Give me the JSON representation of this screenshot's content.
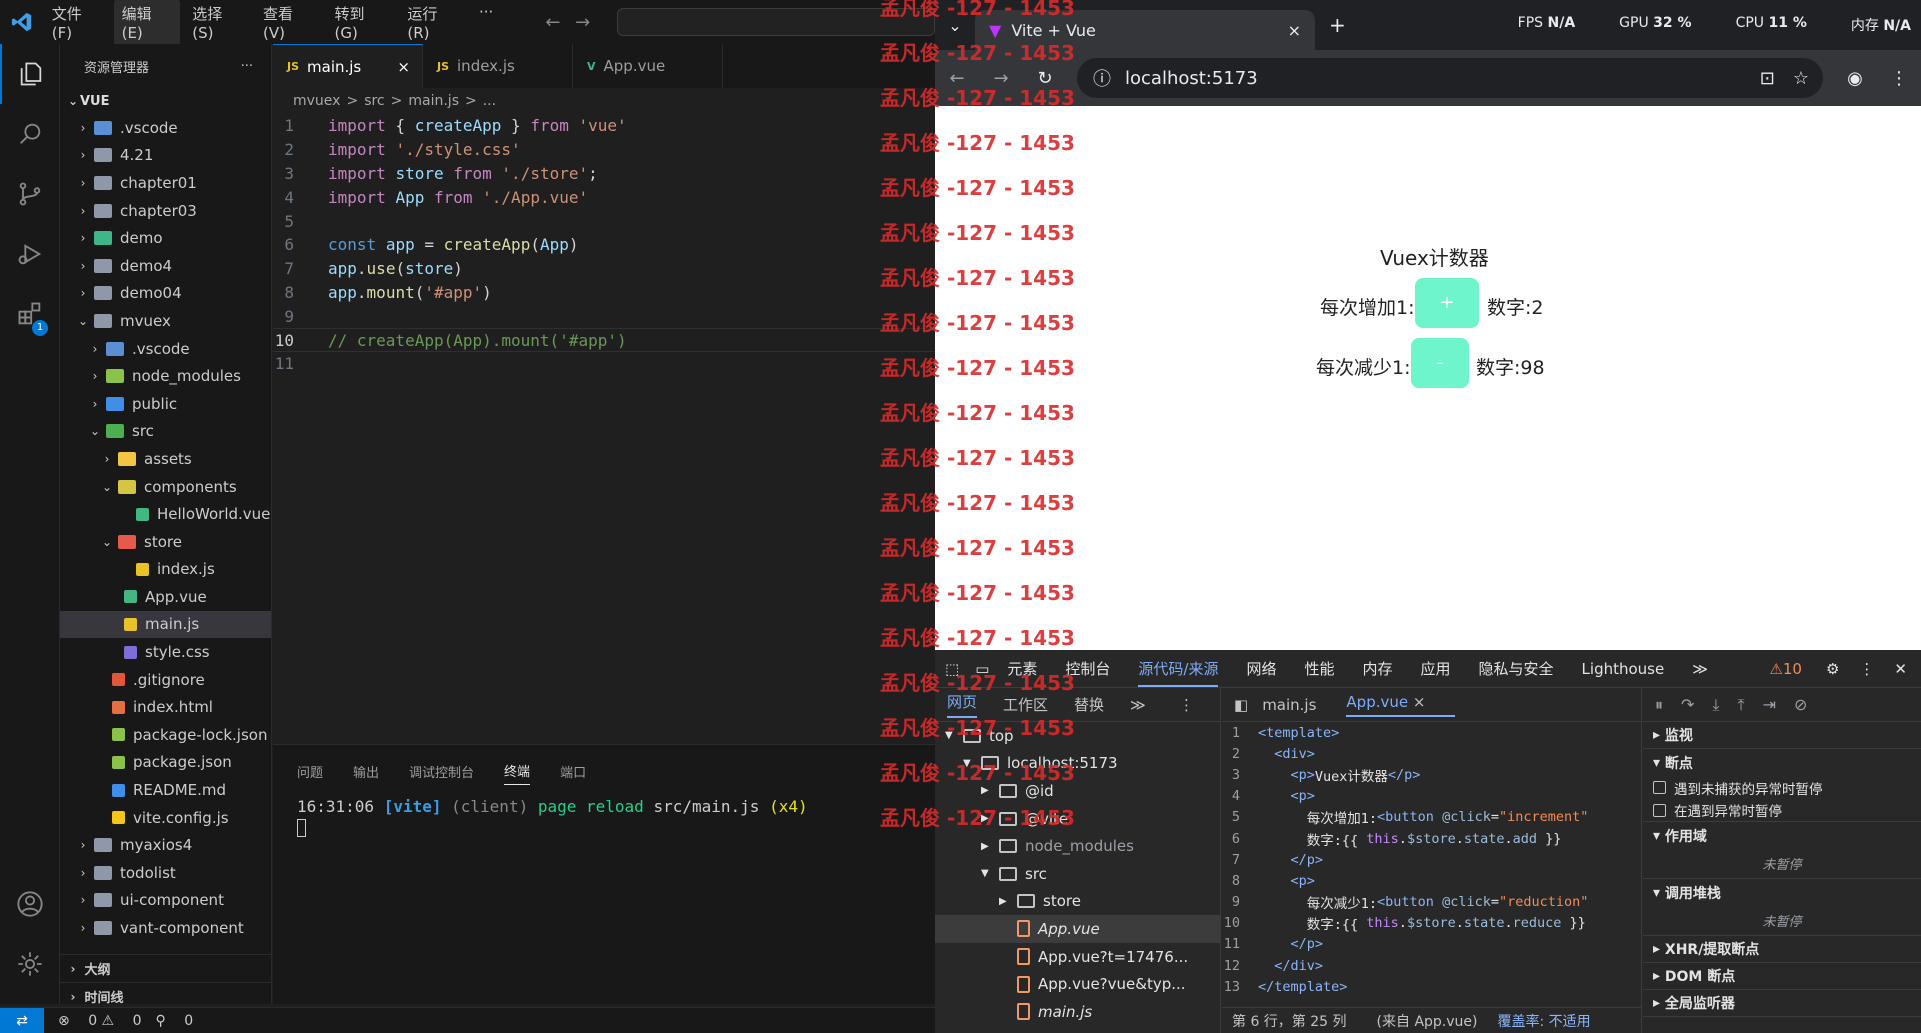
{
  "vscode": {
    "menus": [
      "文件(F)",
      "编辑(E)",
      "选择(S)",
      "查看(V)",
      "转到(G)",
      "运行(R)",
      "···"
    ],
    "explorer": {
      "title": "资源管理器",
      "more": "···",
      "root": "VUE",
      "items": [
        {
          "label": ".vscode",
          "indent": 1,
          "chev": "›",
          "color": "#5a8fd6"
        },
        {
          "label": "4.21",
          "indent": 1,
          "chev": "›",
          "color": "#8f98a8"
        },
        {
          "label": "chapter01",
          "indent": 1,
          "chev": "›",
          "color": "#8f98a8"
        },
        {
          "label": "chapter03",
          "indent": 1,
          "chev": "›",
          "color": "#8f98a8"
        },
        {
          "label": "demo",
          "indent": 1,
          "chev": "›",
          "color": "#3fb58a"
        },
        {
          "label": "demo4",
          "indent": 1,
          "chev": "›",
          "color": "#8f98a8"
        },
        {
          "label": "demo04",
          "indent": 1,
          "chev": "›",
          "color": "#8f98a8"
        },
        {
          "label": "mvuex",
          "indent": 1,
          "chev": "⌄",
          "color": "#8f98a8"
        },
        {
          "label": ".vscode",
          "indent": 2,
          "chev": "›",
          "color": "#5a8fd6"
        },
        {
          "label": "node_modules",
          "indent": 2,
          "chev": "›",
          "color": "#8bc34a"
        },
        {
          "label": "public",
          "indent": 2,
          "chev": "›",
          "color": "#3f8fe8"
        },
        {
          "label": "src",
          "indent": 2,
          "chev": "⌄",
          "color": "#4caf50"
        },
        {
          "label": "assets",
          "indent": 3,
          "chev": "›",
          "color": "#f4c542"
        },
        {
          "label": "components",
          "indent": 3,
          "chev": "⌄",
          "color": "#d4c542"
        },
        {
          "label": "HelloWorld.vue",
          "indent": 4,
          "chev": "",
          "color": "#41b883"
        },
        {
          "label": "store",
          "indent": 3,
          "chev": "⌄",
          "color": "#e45b4d"
        },
        {
          "label": "index.js",
          "indent": 4,
          "chev": "",
          "color": "#e8c228"
        },
        {
          "label": "App.vue",
          "indent": 3,
          "chev": "",
          "color": "#41b883"
        },
        {
          "label": "main.js",
          "indent": 3,
          "chev": "",
          "color": "#e8c228",
          "selected": true
        },
        {
          "label": "style.css",
          "indent": 3,
          "chev": "",
          "color": "#7e6fd8"
        },
        {
          "label": ".gitignore",
          "indent": 2,
          "chev": "",
          "color": "#e2573a"
        },
        {
          "label": "index.html",
          "indent": 2,
          "chev": "",
          "color": "#e5703f"
        },
        {
          "label": "package-lock.json",
          "indent": 2,
          "chev": "",
          "color": "#8bc34a"
        },
        {
          "label": "package.json",
          "indent": 2,
          "chev": "",
          "color": "#8bc34a"
        },
        {
          "label": "README.md",
          "indent": 2,
          "chev": "",
          "color": "#3f8fe8"
        },
        {
          "label": "vite.config.js",
          "indent": 2,
          "chev": "",
          "color": "#f5c518"
        },
        {
          "label": "myaxios4",
          "indent": 1,
          "chev": "›",
          "color": "#8f98a8"
        },
        {
          "label": "todolist",
          "indent": 1,
          "chev": "›",
          "color": "#8f98a8"
        },
        {
          "label": "ui-component",
          "indent": 1,
          "chev": "›",
          "color": "#8f98a8"
        },
        {
          "label": "vant-component",
          "indent": 1,
          "chev": "›",
          "color": "#8f98a8"
        }
      ],
      "outline": "大纲",
      "timeline": "时间线"
    },
    "tabs": [
      {
        "label": "main.js",
        "active": true,
        "icon": "JS",
        "close": "×"
      },
      {
        "label": "index.js",
        "active": false,
        "icon": "JS"
      },
      {
        "label": "App.vue",
        "active": false,
        "icon": "V"
      }
    ],
    "breadcrumb": [
      "mvuex",
      ">",
      "src",
      ">",
      "main.js",
      ">",
      "..."
    ],
    "code": [
      [
        [
          "kw",
          "import"
        ],
        [
          "pl",
          " { "
        ],
        [
          "var",
          "createApp"
        ],
        [
          "pl",
          " } "
        ],
        [
          "kw",
          "from"
        ],
        [
          "pl",
          " "
        ],
        [
          "str",
          "'vue'"
        ]
      ],
      [
        [
          "kw",
          "import"
        ],
        [
          "pl",
          " "
        ],
        [
          "str",
          "'./style.css'"
        ]
      ],
      [
        [
          "kw",
          "import"
        ],
        [
          "pl",
          " "
        ],
        [
          "var",
          "store"
        ],
        [
          "pl",
          " "
        ],
        [
          "kw",
          "from"
        ],
        [
          "pl",
          " "
        ],
        [
          "str",
          "'./store'"
        ],
        [
          "pl",
          ";"
        ]
      ],
      [
        [
          "kw",
          "import"
        ],
        [
          "pl",
          " "
        ],
        [
          "var",
          "App"
        ],
        [
          "pl",
          " "
        ],
        [
          "kw",
          "from"
        ],
        [
          "pl",
          " "
        ],
        [
          "str",
          "'./App.vue'"
        ]
      ],
      [],
      [
        [
          "kb",
          "const"
        ],
        [
          "pl",
          " "
        ],
        [
          "var",
          "app"
        ],
        [
          "pl",
          " = "
        ],
        [
          "fn",
          "createApp"
        ],
        [
          "pl",
          "("
        ],
        [
          "var",
          "App"
        ],
        [
          "pl",
          ")"
        ]
      ],
      [
        [
          "var",
          "app"
        ],
        [
          "pl",
          "."
        ],
        [
          "fn",
          "use"
        ],
        [
          "pl",
          "("
        ],
        [
          "var",
          "store"
        ],
        [
          "pl",
          ")"
        ]
      ],
      [
        [
          "var",
          "app"
        ],
        [
          "pl",
          "."
        ],
        [
          "fn",
          "mount"
        ],
        [
          "pl",
          "("
        ],
        [
          "str",
          "'#app'"
        ],
        [
          "pl",
          ")"
        ]
      ],
      [],
      [
        [
          "cm",
          "// createApp(App).mount('#app')"
        ]
      ],
      []
    ],
    "current_line": 10,
    "panel_tabs": [
      "问题",
      "输出",
      "调试控制台",
      "终端",
      "端口"
    ],
    "active_panel_tab": "终端",
    "terminal": {
      "time": "16:31:06",
      "tag": "[vite]",
      "client": "(client)",
      "msg": "page reload",
      "file": "src/main.js",
      "count": "(x4)"
    },
    "status": {
      "errors": "0",
      "warnings": "0",
      "ports": "0"
    }
  },
  "watermark": {
    "text": "孟凡俊 -127 - 1453"
  },
  "chrome": {
    "tab_title": "Vite + Vue",
    "tab_close": "×",
    "new_tab": "+",
    "perf": {
      "fps_label": "FPS",
      "fps": "N/A",
      "gpu_label": "GPU",
      "gpu": "32 %",
      "cpu_label": "CPU",
      "cpu": "11 %",
      "mem_label": "内存",
      "mem": "N/A"
    },
    "url": "localhost:5173",
    "page": {
      "title": "Vuex计数器",
      "inc_label": "每次增加1:",
      "inc_btn": "+",
      "inc_value": "数字:2",
      "dec_label": "每次减少1:",
      "dec_btn": "-",
      "dec_value": "数字:98"
    },
    "devtools": {
      "tabs": [
        "元素",
        "控制台",
        "源代码/来源",
        "网络",
        "性能",
        "内存",
        "应用",
        "隐私与安全",
        "Lighthouse",
        "≫"
      ],
      "active_tab": "源代码/来源",
      "warnings": "⚠10",
      "nav_tabs": [
        "网页",
        "工作区",
        "替换",
        "≫"
      ],
      "tree": [
        {
          "label": "top",
          "indent": 0,
          "chev": "▼"
        },
        {
          "label": "localhost:5173",
          "indent": 1,
          "chev": "▼"
        },
        {
          "label": "@id",
          "indent": 2,
          "chev": "▶"
        },
        {
          "label": "@vite",
          "indent": 2,
          "chev": "▶"
        },
        {
          "label": "node_modules",
          "indent": 2,
          "chev": "▶",
          "dim": true
        },
        {
          "label": "src",
          "indent": 2,
          "chev": "▼"
        },
        {
          "label": "store",
          "indent": 3,
          "chev": "▶"
        },
        {
          "label": "App.vue",
          "indent": 3,
          "chev": "",
          "file": true,
          "selected": true,
          "italic": true
        },
        {
          "label": "App.vue?t=17476...",
          "indent": 3,
          "chev": "",
          "file": true
        },
        {
          "label": "App.vue?vue&typ...",
          "indent": 3,
          "chev": "",
          "file": true
        },
        {
          "label": "main.js",
          "indent": 3,
          "chev": "",
          "file": true,
          "italic": true
        }
      ],
      "src_tabs": [
        "main.js",
        "App.vue"
      ],
      "src_close": "×",
      "src_lines": [
        [
          [
            "tg",
            "<template>"
          ]
        ],
        [
          [
            "pl",
            "  "
          ],
          [
            "tg",
            "<div>"
          ]
        ],
        [
          [
            "pl",
            "    "
          ],
          [
            "tg",
            "<p>"
          ],
          [
            "tx",
            "Vuex计数器"
          ],
          [
            "tg",
            "</p>"
          ]
        ],
        [
          [
            "pl",
            "    "
          ],
          [
            "tg",
            "<p>"
          ]
        ],
        [
          [
            "tx",
            "      每次增加1:"
          ],
          [
            "tg",
            "<button "
          ],
          [
            "at",
            "@click"
          ],
          [
            "tx",
            "="
          ],
          [
            "av",
            "\"increment\""
          ]
        ],
        [
          [
            "tx",
            "      数字:{{ "
          ],
          [
            "pu",
            "this"
          ],
          [
            "tx",
            "."
          ],
          [
            "at",
            "$store"
          ],
          [
            "tx",
            "."
          ],
          [
            "at",
            "state"
          ],
          [
            "tx",
            "."
          ],
          [
            "at",
            "add"
          ],
          [
            "tx",
            " }}"
          ]
        ],
        [
          [
            "pl",
            "    "
          ],
          [
            "tg",
            "</p>"
          ]
        ],
        [
          [
            "pl",
            "    "
          ],
          [
            "tg",
            "<p>"
          ]
        ],
        [
          [
            "tx",
            "      每次减少1:"
          ],
          [
            "tg",
            "<button "
          ],
          [
            "at",
            "@click"
          ],
          [
            "tx",
            "="
          ],
          [
            "av",
            "\"reduction\""
          ]
        ],
        [
          [
            "tx",
            "      数字:{{ "
          ],
          [
            "pu",
            "this"
          ],
          [
            "tx",
            "."
          ],
          [
            "at",
            "$store"
          ],
          [
            "tx",
            "."
          ],
          [
            "at",
            "state"
          ],
          [
            "tx",
            "."
          ],
          [
            "at",
            "reduce"
          ],
          [
            "tx",
            " }}"
          ]
        ],
        [
          [
            "pl",
            "    "
          ],
          [
            "tg",
            "</p>"
          ]
        ],
        [
          [
            "pl",
            "  "
          ],
          [
            "tg",
            "</div>"
          ]
        ],
        [
          [
            "tg",
            "</template>"
          ]
        ]
      ],
      "src_status": {
        "pos": "第 6 行，第 25 列",
        "from": "(来自 App.vue)",
        "coverage": "覆盖率: 不适用"
      },
      "debug": {
        "watch": "监视",
        "breakpoints": "断点",
        "cb1": "遇到未捕获的异常时暂停",
        "cb2": "在遇到异常时暂停",
        "scope": "作用域",
        "not_paused": "未暂停",
        "callstack": "调用堆栈",
        "not_paused2": "未暂停",
        "xhr": "XHR/提取断点",
        "dom": "DOM 断点",
        "global": "全局监听器"
      }
    }
  }
}
